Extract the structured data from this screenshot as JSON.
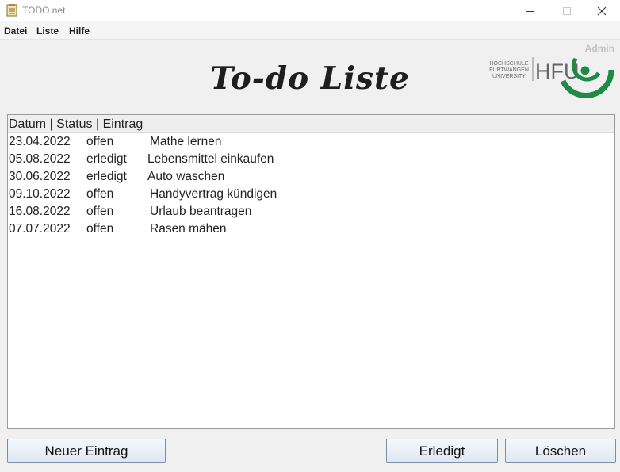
{
  "window": {
    "title": "TODO.net"
  },
  "menu": {
    "items": [
      "Datei",
      "Liste",
      "Hilfe"
    ]
  },
  "header": {
    "user_label": "Admin",
    "title": "To-do Liste"
  },
  "logo": {
    "line1": "HOCHSCHULE",
    "line2": "FURTWANGEN",
    "line3": "UNIVERSITY",
    "abbr": "HFU",
    "color": "#1f8a45"
  },
  "list": {
    "header": "Datum | Status | Eintrag",
    "rows": [
      {
        "date": "23.04.2022",
        "status": "offen",
        "entry": "Mathe lernen"
      },
      {
        "date": "05.08.2022",
        "status": "erledigt",
        "entry": "Lebensmittel einkaufen"
      },
      {
        "date": "30.06.2022",
        "status": "erledigt",
        "entry": "Auto waschen"
      },
      {
        "date": "09.10.2022",
        "status": "offen",
        "entry": "Handyvertrag kündigen"
      },
      {
        "date": "16.08.2022",
        "status": "offen",
        "entry": "Urlaub beantragen"
      },
      {
        "date": "07.07.2022",
        "status": "offen",
        "entry": "Rasen mähen"
      }
    ]
  },
  "buttons": {
    "new_entry": "Neuer Eintrag",
    "done": "Erledigt",
    "delete": "Löschen"
  }
}
